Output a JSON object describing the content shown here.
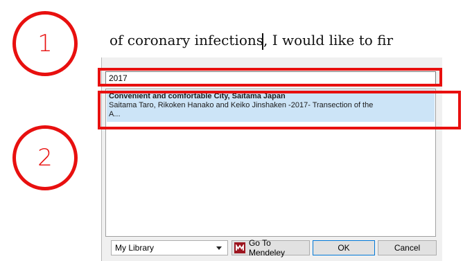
{
  "callouts": [
    "1",
    "2"
  ],
  "document": {
    "text": "of coronary infections",
    "text_after_caret": ", I would like to fir"
  },
  "dialog": {
    "search": {
      "value": "2017"
    },
    "results": [
      {
        "title": "Convenient and comfortable City, Saitama Japan",
        "line2": "Saitama Taro, Rikoken Hanako and Keiko Jinshaken -2017- Transection of the",
        "line3": "A..."
      }
    ],
    "library_select": "My Library",
    "goto_button": "Go To Mendeley",
    "ok_button": "OK",
    "cancel_button": "Cancel"
  },
  "colors": {
    "annotation_red": "#e8100f",
    "selection_blue": "#cce4f7",
    "mendeley_red": "#9d1620"
  },
  "icons": {
    "mendeley": "mendeley-logo-icon",
    "dropdown": "chevron-down-icon"
  }
}
